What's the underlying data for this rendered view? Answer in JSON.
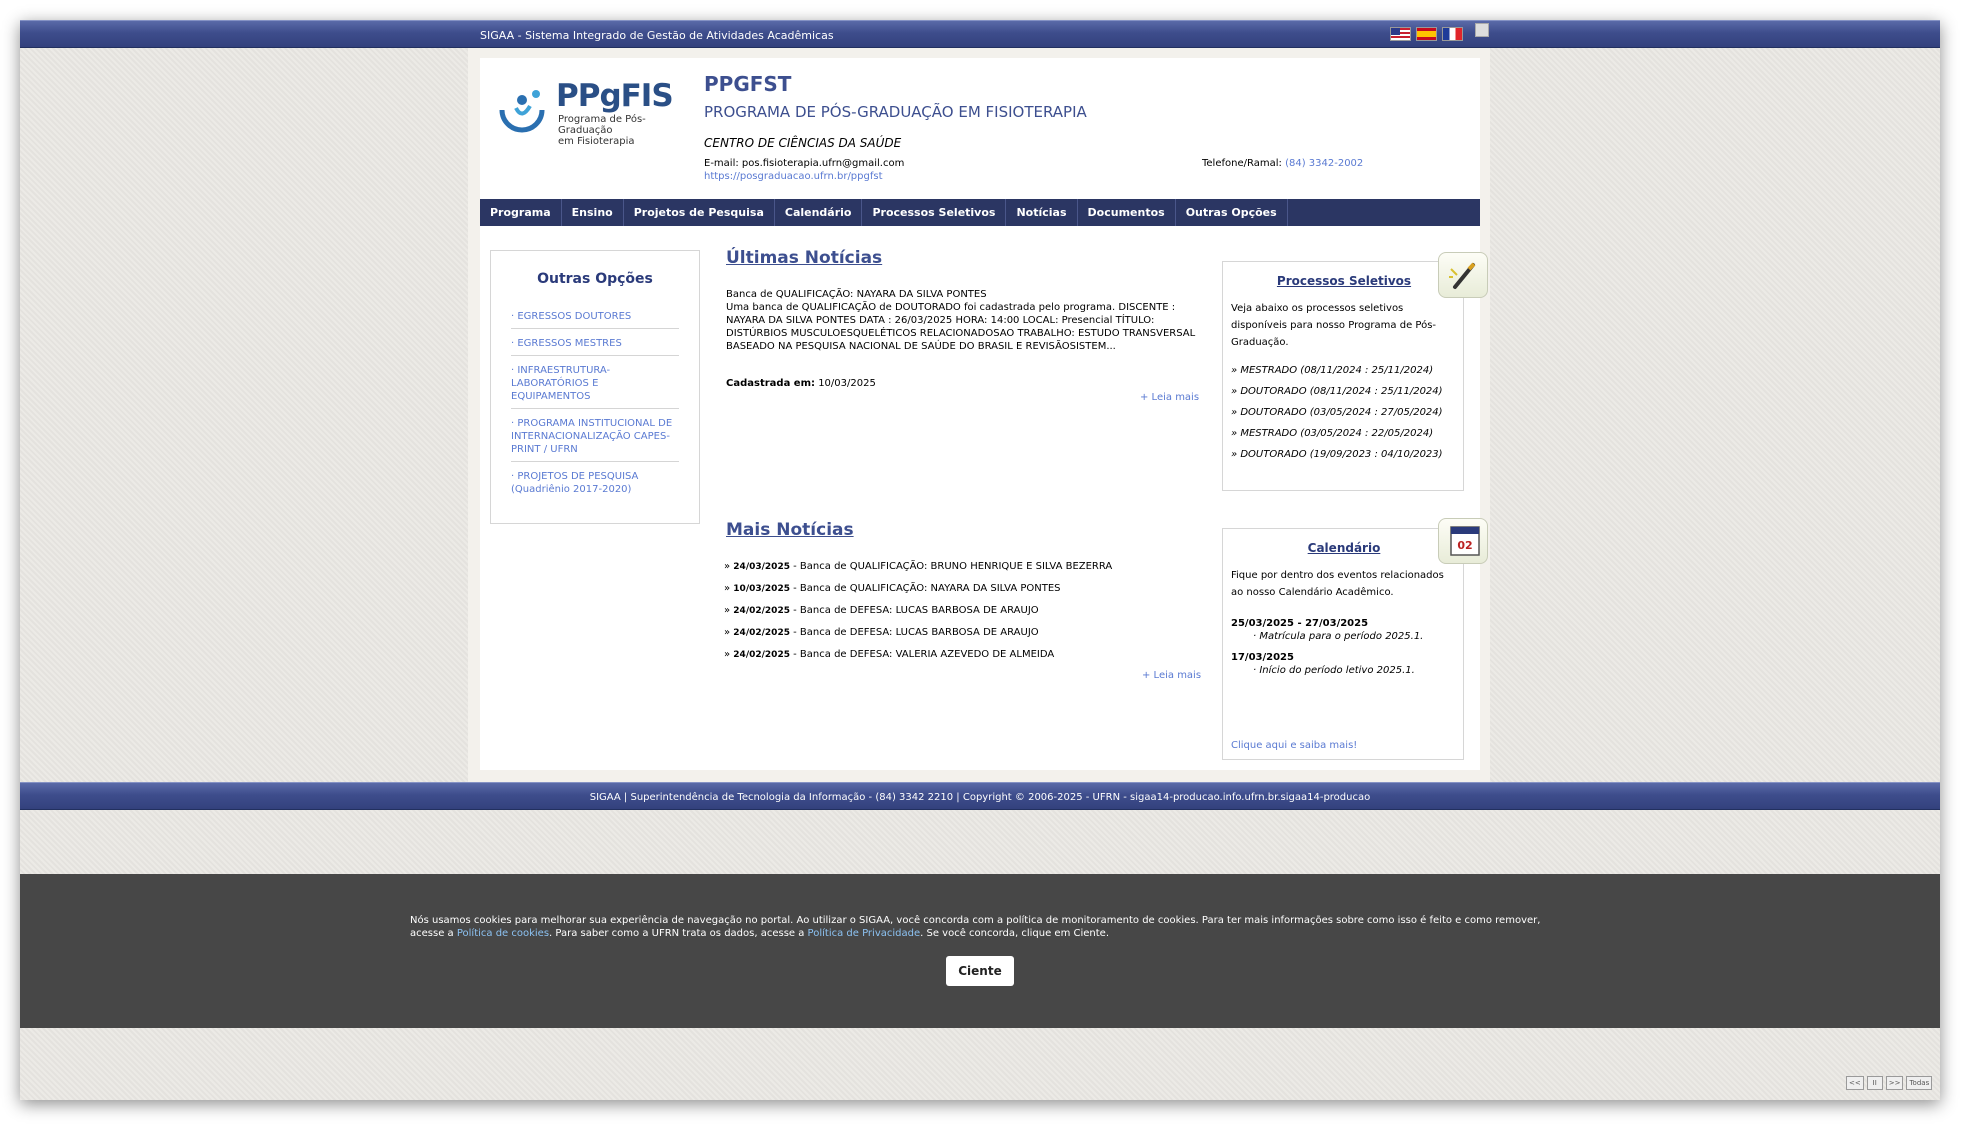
{
  "topbar": {
    "title": "SIGAA - Sistema Integrado de Gestão de Atividades Acadêmicas",
    "flags": [
      "us-flag",
      "spain-flag",
      "france-flag"
    ]
  },
  "header": {
    "logo_big": "PPgFIS",
    "logo_small_line1": "Programa de Pós-Graduação",
    "logo_small_line2": "em Fisioterapia",
    "program_code": "PPGFST",
    "program_name": "PROGRAMA DE PÓS-GRADUAÇÃO EM FISIOTERAPIA",
    "center": "CENTRO DE CIÊNCIAS DA SAÚDE",
    "email_label": "E-mail: pos.fisioterapia.ufrn@gmail.com",
    "url": "https://posgraduacao.ufrn.br/ppgfst",
    "phone_label": "Telefone/Ramal:",
    "phone": "(84) 3342-2002"
  },
  "nav": [
    "Programa",
    "Ensino",
    "Projetos de Pesquisa",
    "Calendário",
    "Processos Seletivos",
    "Notícias",
    "Documentos",
    "Outras Opções"
  ],
  "sidebar": {
    "title": "Outras Opções",
    "links": [
      "· EGRESSOS DOUTORES",
      "· EGRESSOS MESTRES",
      "· INFRAESTRUTURA-LABORATÓRIOS E EQUIPAMENTOS",
      "· PROGRAMA INSTITUCIONAL DE INTERNACIONALIZAÇÃO CAPES-PRINT / UFRN",
      "· PROJETOS DE PESQUISA (Quadriênio 2017-2020)"
    ]
  },
  "news": {
    "title": "Últimas Notícias",
    "headline": "Banca de QUALIFICAÇÃO: NAYARA DA SILVA PONTES",
    "body": "Uma banca de QUALIFICAÇÃO de DOUTORADO foi cadastrada pelo programa. DISCENTE : NAYARA DA SILVA PONTES DATA : 26/03/2025 HORA: 14:00 LOCAL: Presencial TÍTULO: DISTÚRBIOS MUSCULOESQUELÉTICOS RELACIONADOSAO TRABALHO: ESTUDO TRANSVERSAL BASEADO NA PESQUISA NACIONAL DE SAÚDE DO BRASIL E REVISÃOSISTEM...",
    "registered_label": "Cadastrada em:",
    "registered_date": "10/03/2025",
    "read_more": "+ Leia mais"
  },
  "more_news": {
    "title": "Mais Notícias",
    "items": [
      {
        "date": "24/03/2025",
        "text": " - Banca de QUALIFICAÇÃO: BRUNO HENRIQUE E SILVA BEZERRA"
      },
      {
        "date": "10/03/2025",
        "text": " - Banca de QUALIFICAÇÃO: NAYARA DA SILVA PONTES"
      },
      {
        "date": "24/02/2025",
        "text": " - Banca de DEFESA: LUCAS BARBOSA DE ARAUJO"
      },
      {
        "date": "24/02/2025",
        "text": " - Banca de DEFESA: LUCAS BARBOSA DE ARAUJO"
      },
      {
        "date": "24/02/2025",
        "text": " - Banca de DEFESA: VALERIA AZEVEDO DE ALMEIDA"
      }
    ],
    "read_more": "+ Leia mais"
  },
  "processos": {
    "title": "Processos Seletivos",
    "desc": "Veja abaixo os processos seletivos disponíveis para nosso Programa de Pós-Graduação.",
    "items": [
      "» MESTRADO (08/11/2024 : 25/11/2024)",
      "» DOUTORADO (08/11/2024 : 25/11/2024)",
      "» DOUTORADO (03/05/2024 : 27/05/2024)",
      "» MESTRADO (03/05/2024 : 22/05/2024)",
      "» DOUTORADO (19/09/2023 : 04/10/2023)"
    ]
  },
  "calendario": {
    "title": "Calendário",
    "icon_day": "02",
    "desc": "Fique por dentro dos eventos relacionados ao nosso Calendário Acadêmico.",
    "events": [
      {
        "date": "25/03/2025 - 27/03/2025",
        "text": "· Matrícula para o período 2025.1."
      },
      {
        "date": "17/03/2025",
        "text": "· Início do período letivo 2025.1."
      }
    ],
    "link": "Clique aqui e saiba mais!"
  },
  "footer": {
    "text": "SIGAA | Superintendência de Tecnologia da Informação - (84) 3342 2210 | Copyright © 2006-2025 - UFRN - sigaa14-producao.info.ufrn.br.sigaa14-producao"
  },
  "cookie": {
    "msg_part1": "Nós usamos cookies para melhorar sua experiência de navegação no portal. Ao utilizar o SIGAA, você concorda com a política de monitoramento de cookies. Para ter mais informações sobre como isso é feito e como remover, acesse a ",
    "link1": "Política de cookies",
    "msg_part2": ". Para saber como a UFRN trata os dados, acesse a ",
    "link2": "Política de Privacidade",
    "msg_part3": ". Se você concorda, clique em Ciente.",
    "button": "Ciente"
  },
  "controls": [
    "<<",
    "II",
    ">>",
    "Todas"
  ]
}
